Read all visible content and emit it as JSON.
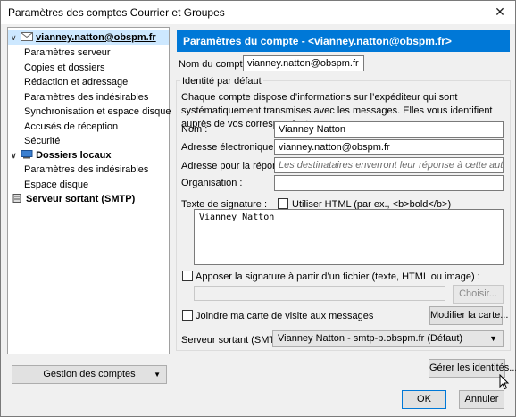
{
  "window": {
    "title": "Paramètres des comptes Courrier et Groupes",
    "close_glyph": "✕"
  },
  "tree": {
    "account": "vianney.natton@obspm.fr",
    "account_children": [
      "Paramètres serveur",
      "Copies et dossiers",
      "Rédaction et adressage",
      "Paramètres des indésirables",
      "Synchronisation et espace disque",
      "Accusés de réception",
      "Sécurité"
    ],
    "local_folders": "Dossiers locaux",
    "local_children": [
      "Paramètres des indésirables",
      "Espace disque"
    ],
    "smtp": "Serveur sortant (SMTP)"
  },
  "manage_button": "Gestion des comptes",
  "panel": {
    "header": "Paramètres du compte - <vianney.natton@obspm.fr>",
    "account_name_label": "Nom du compte :",
    "account_name_value": "vianney.natton@obspm.fr",
    "identity_group": "Identité par défaut",
    "identity_desc": "Chaque compte dispose d’informations sur l’expéditeur qui sont systématiquement transmises avec les messages. Elles vous identifient auprès de vos correspondants.",
    "name_label": "Nom :",
    "name_value": "Vianney Natton",
    "email_label": "Adresse électronique :",
    "email_value": "vianney.natton@obspm.fr",
    "reply_label": "Adresse pour la réponse :",
    "reply_placeholder": "Les destinataires enverront leur réponse à cette autre adresse",
    "org_label": "Organisation :",
    "org_value": "",
    "sig_label": "Texte de signature :",
    "use_html": "Utiliser HTML (par ex., <b>bold</b>)",
    "signature_text": "Vianney Natton",
    "attach_sig": "Apposer la signature à partir d’un fichier (texte, HTML ou image) :",
    "choose_button": "Choisir...",
    "vcard": "Joindre ma carte de visite aux messages",
    "edit_card": "Modifier la carte...",
    "smtp_label": "Serveur sortant (SMTP) :",
    "smtp_value": "Vianney Natton - smtp-p.obspm.fr (Défaut)",
    "manage_identities": "Gérer les identités..."
  },
  "footer": {
    "ok": "OK",
    "cancel": "Annuler"
  },
  "colors": {
    "accent": "#0078d7",
    "selection": "#cde8ff"
  }
}
